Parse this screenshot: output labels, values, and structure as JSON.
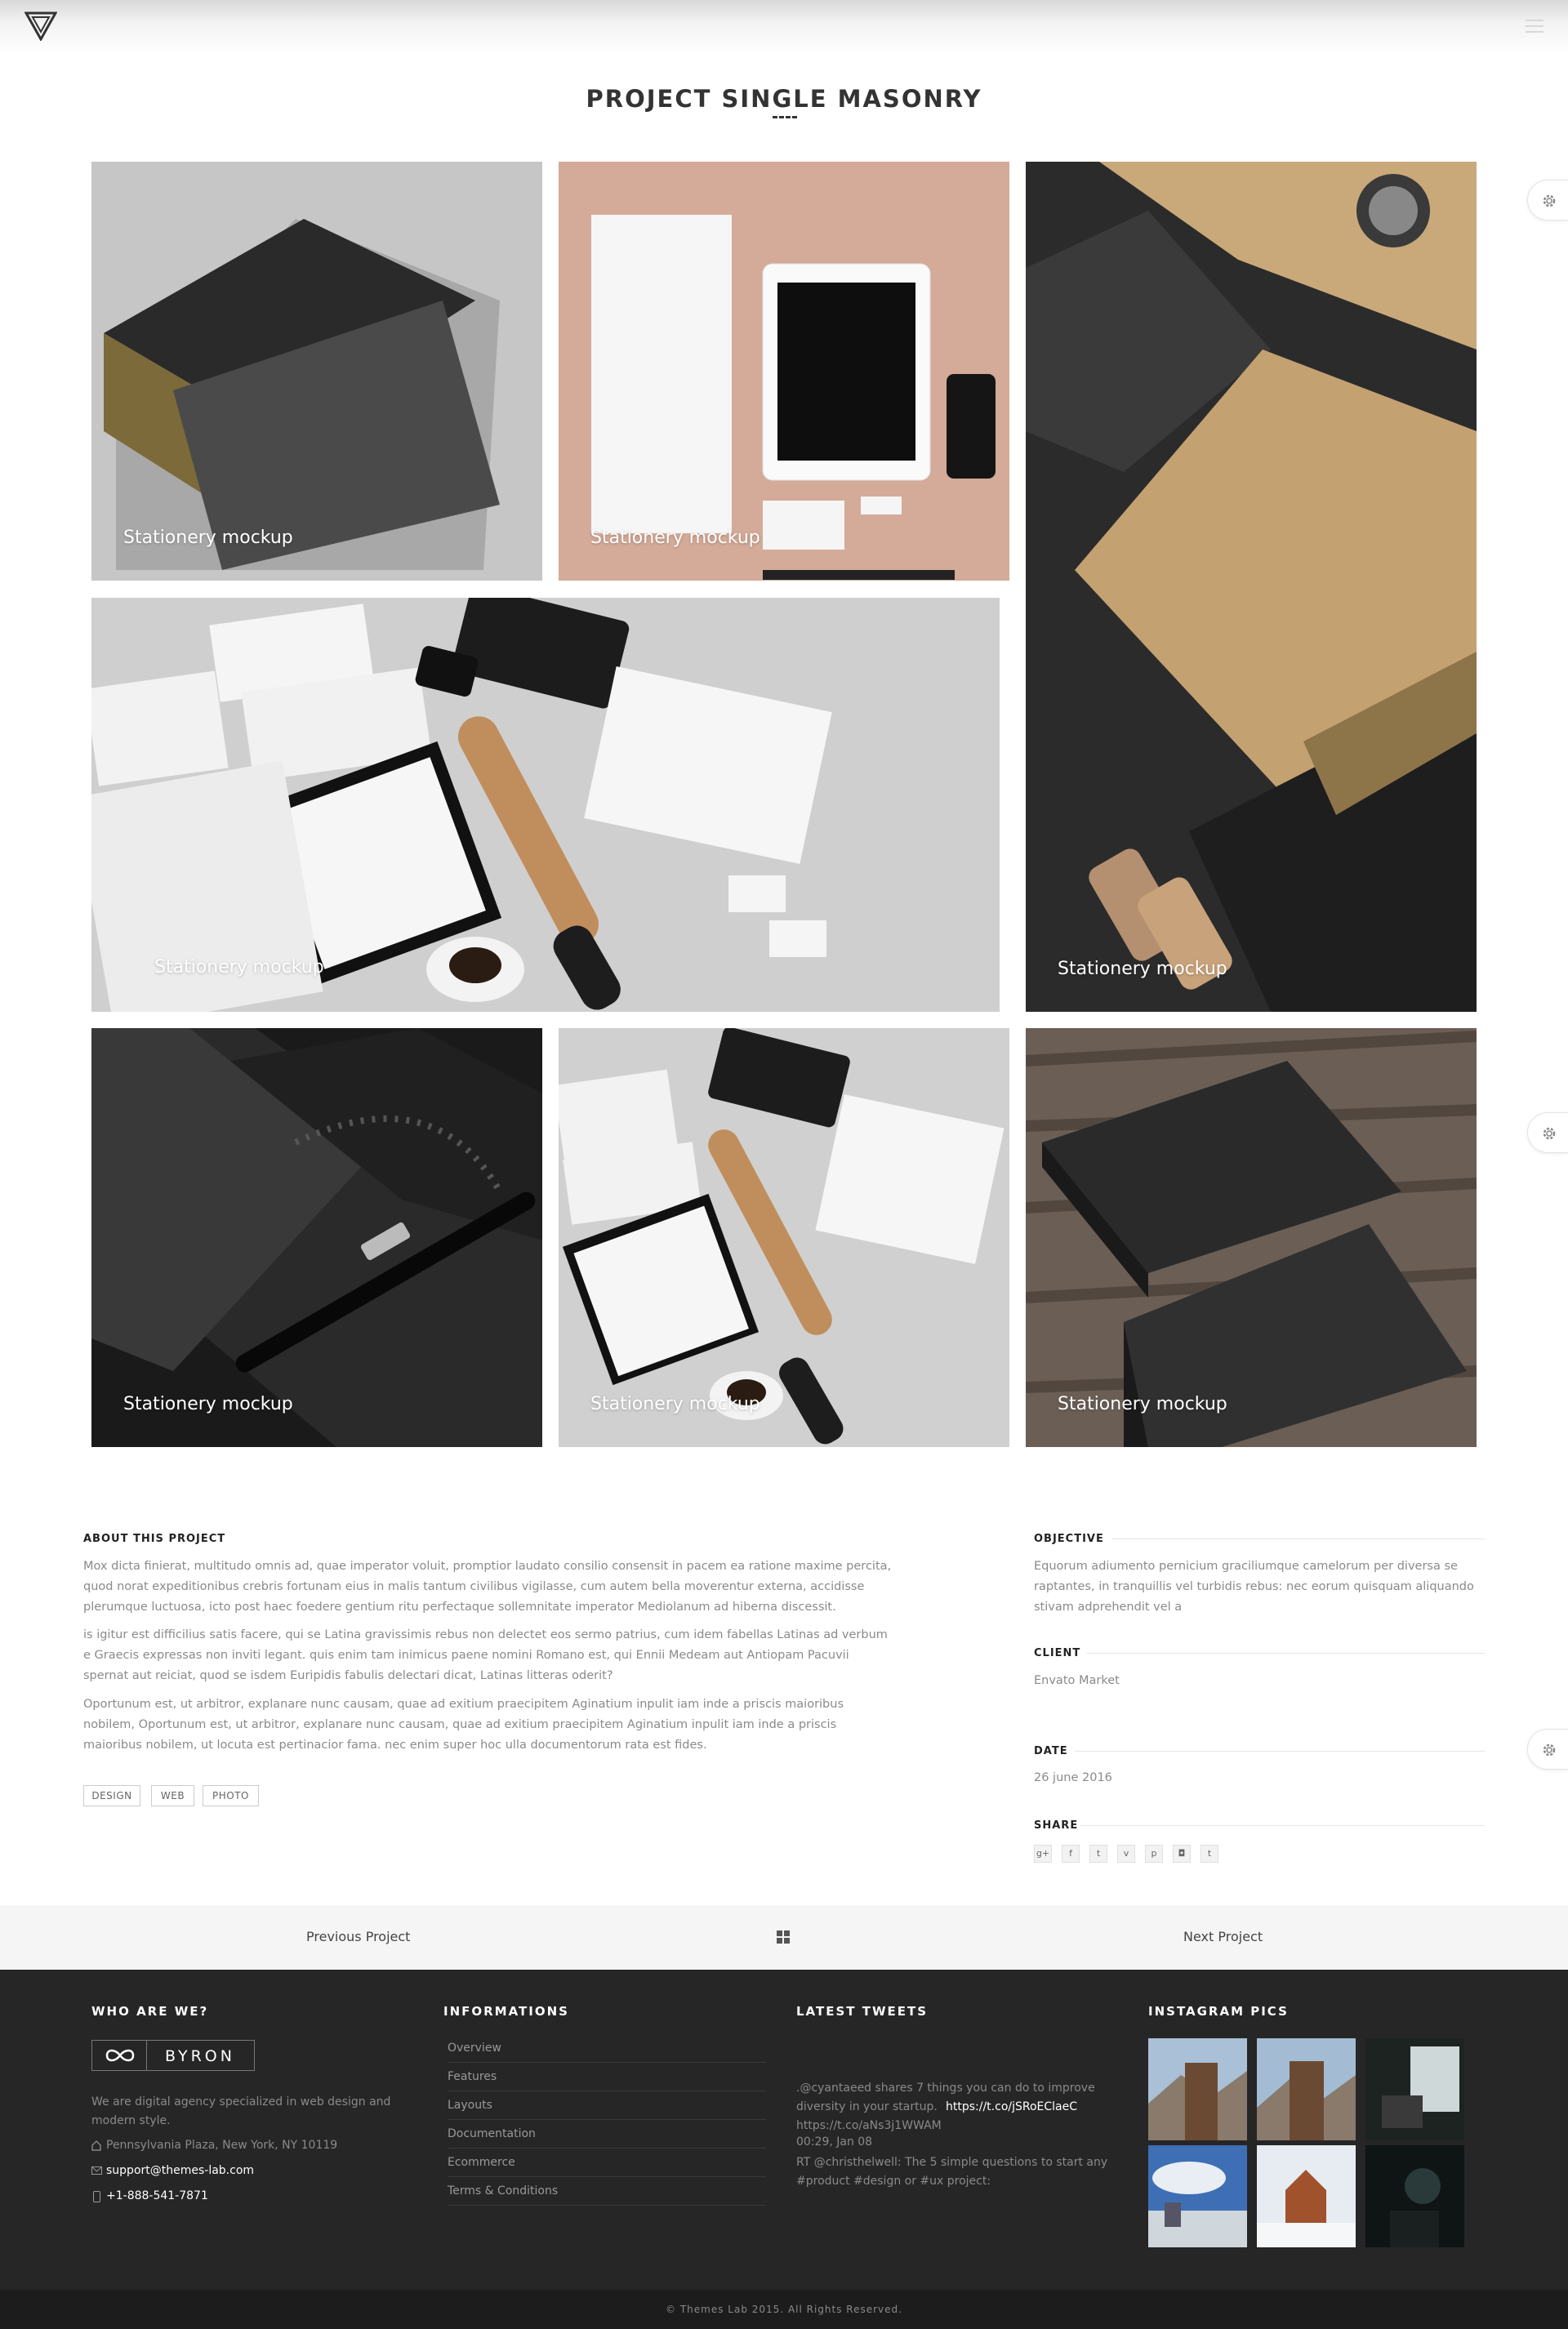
{
  "page": {
    "title": "PROJECT SINGLE MASONRY"
  },
  "gallery": {
    "tiles": [
      {
        "caption": "Stationery mockup"
      },
      {
        "caption": "Stationery mockup"
      },
      {
        "caption": "Stationery mockup"
      },
      {
        "caption": "Stationery mockup"
      },
      {
        "caption": "Stationery mockup"
      },
      {
        "caption": "Stationery mockup"
      },
      {
        "caption": "Stationery mockup"
      }
    ]
  },
  "about": {
    "heading": "ABOUT THIS PROJECT",
    "p1": "Mox dicta finierat, multitudo omnis ad, quae imperator voluit, promptior laudato consilio consensit in pacem ea ratione maxime percita, quod norat expeditionibus crebris fortunam eius in malis tantum civilibus vigilasse, cum autem bella moverentur externa, accidisse plerumque luctuosa, icto post haec foedere gentium ritu perfectaque sollemnitate imperator Mediolanum ad hiberna discessit.",
    "p2": "is igitur est difficilius satis facere, qui se Latina gravissimis rebus non delectet eos sermo patrius, cum idem fabellas Latinas ad verbum e Graecis expressas non inviti legant. quis enim tam inimicus paene nomini Romano est, qui Ennii Medeam aut Antiopam Pacuvii spernat aut reiciat, quod se isdem Euripidis fabulis delectari dicat, Latinas litteras oderit?",
    "p3": "Oportunum est, ut arbitror, explanare nunc causam, quae ad exitium praecipitem Aginatium inpulit iam inde a priscis maioribus nobilem, Oportunum est, ut arbitror, explanare nunc causam, quae ad exitium praecipitem Aginatium inpulit iam inde a priscis maioribus nobilem, ut locuta est pertinacior fama. nec enim super hoc ulla documentorum rata est fides.",
    "tags": [
      "DESIGN",
      "WEB",
      "PHOTO"
    ]
  },
  "details": {
    "objective_label": "OBJECTIVE",
    "objective": "Equorum adiumento pernicium graciliumque camelorum per diversa se raptantes, in tranquillis vel turbidis rebus: nec eorum quisquam aliquando stivam adprehendit vel a",
    "client_label": "CLIENT",
    "client": "Envato Market",
    "date_label": "DATE",
    "date": "26 june 2016",
    "share_label": "SHARE",
    "share_icons": [
      "g+",
      "f",
      "t",
      "v",
      "p",
      "◘",
      "t"
    ]
  },
  "project_nav": {
    "previous": "Previous Project",
    "next": "Next Project"
  },
  "footer": {
    "who_heading": "WHO ARE WE?",
    "brand_name": "BYRON",
    "about": "We are digital agency specialized in web design and modern style.",
    "address": "Pennsylvania Plaza, New York, NY 10119",
    "email": "support@themes-lab.com",
    "phone": "+1-888-541-7871",
    "info_heading": "INFORMATIONS",
    "info_links": [
      "Overview",
      "Features",
      "Layouts",
      "Documentation",
      "Ecommerce",
      "Terms & Conditions"
    ],
    "tweets_heading": "LATEST TWEETS",
    "tweet1_text": ".@cyantaeed shares 7 things you can do to improve diversity in your startup.",
    "tweet1_link": "https://t.co/jSRoEClaeC",
    "tweet1_link2": "https://t.co/aNs3j1WWAM",
    "tweet1_time": "00:29, Jan 08",
    "tweet2_text": "RT @christhelwell: The 5 simple questions to start any #product #design or #ux project:",
    "insta_heading": "INSTAGRAM PICS",
    "copyright": "© Themes Lab 2015. All Rights Reserved."
  },
  "colors": {
    "footer_bg": "#262626",
    "accent": "#333333"
  },
  "icons": [
    "logo-triangle-icon",
    "hamburger-menu-icon",
    "gear-icon",
    "grid-icon",
    "map-pin-icon",
    "mail-icon",
    "phone-icon",
    "infinity-logo-icon"
  ]
}
